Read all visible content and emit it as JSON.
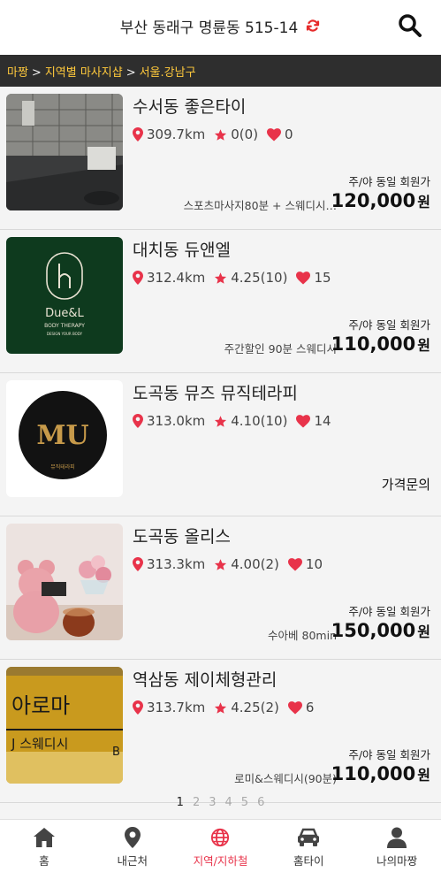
{
  "header": {
    "location": "부산 동래구 명륜동 515-14"
  },
  "breadcrumb": [
    "마짱",
    "지역별 마사지샵",
    "서울.강남구"
  ],
  "listings": [
    {
      "title": "수서동 좋은타이",
      "distance": "309.7km",
      "rating": "0(0)",
      "likes": "0",
      "sub_label": "주/야 동일 회원가",
      "description": "스포츠마사지80분 + 스웨디시…",
      "price": "120,000",
      "currency": "원",
      "ask_label": ""
    },
    {
      "title": "대치동 듀앤엘",
      "distance": "312.4km",
      "rating": "4.25(10)",
      "likes": "15",
      "sub_label": "주/야 동일 회원가",
      "description": "주간할인 90분 스웨디시",
      "price": "110,000",
      "currency": "원",
      "ask_label": ""
    },
    {
      "title": "도곡동 뮤즈 뮤직테라피",
      "distance": "313.0km",
      "rating": "4.10(10)",
      "likes": "14",
      "sub_label": "",
      "description": "",
      "price": "",
      "currency": "",
      "ask_label": "가격문의"
    },
    {
      "title": "도곡동 올리스",
      "distance": "313.3km",
      "rating": "4.00(2)",
      "likes": "10",
      "sub_label": "주/야 동일 회원가",
      "description": "수아베 80min",
      "price": "150,000",
      "currency": "원",
      "ask_label": ""
    },
    {
      "title": "역삼동 제이체형관리",
      "distance": "313.7km",
      "rating": "4.25(2)",
      "likes": "6",
      "sub_label": "주/야 동일 회원가",
      "description": "로미&스웨디시(90분)",
      "price": "110,000",
      "currency": "원",
      "ask_label": ""
    }
  ],
  "thumbs": {
    "duel": {
      "brand": "Due&L",
      "tagline": "BODY THERAPY",
      "small": "DESIGN YOUR BODY"
    },
    "muse": {
      "brand": "MU",
      "small": "뮤직테라피"
    },
    "jsign": {
      "line1": "아로마",
      "line2": "J 스웨디시",
      "extra": "B"
    }
  },
  "pagination": {
    "pages": [
      "1",
      "2",
      "3",
      "4",
      "5",
      "6"
    ],
    "current": "1"
  },
  "tabs": [
    {
      "label": "홈",
      "icon": "home-icon"
    },
    {
      "label": "내근처",
      "icon": "location-pin-icon"
    },
    {
      "label": "지역/지하철",
      "icon": "globe-icon"
    },
    {
      "label": "홈타이",
      "icon": "car-icon"
    },
    {
      "label": "나의마짱",
      "icon": "user-icon"
    }
  ],
  "colors": {
    "accent": "#e8334a",
    "breadcrumb_link": "#ffc93c",
    "breadcrumb_bg": "#2e2e2e",
    "refresh": "#e62b2b"
  }
}
